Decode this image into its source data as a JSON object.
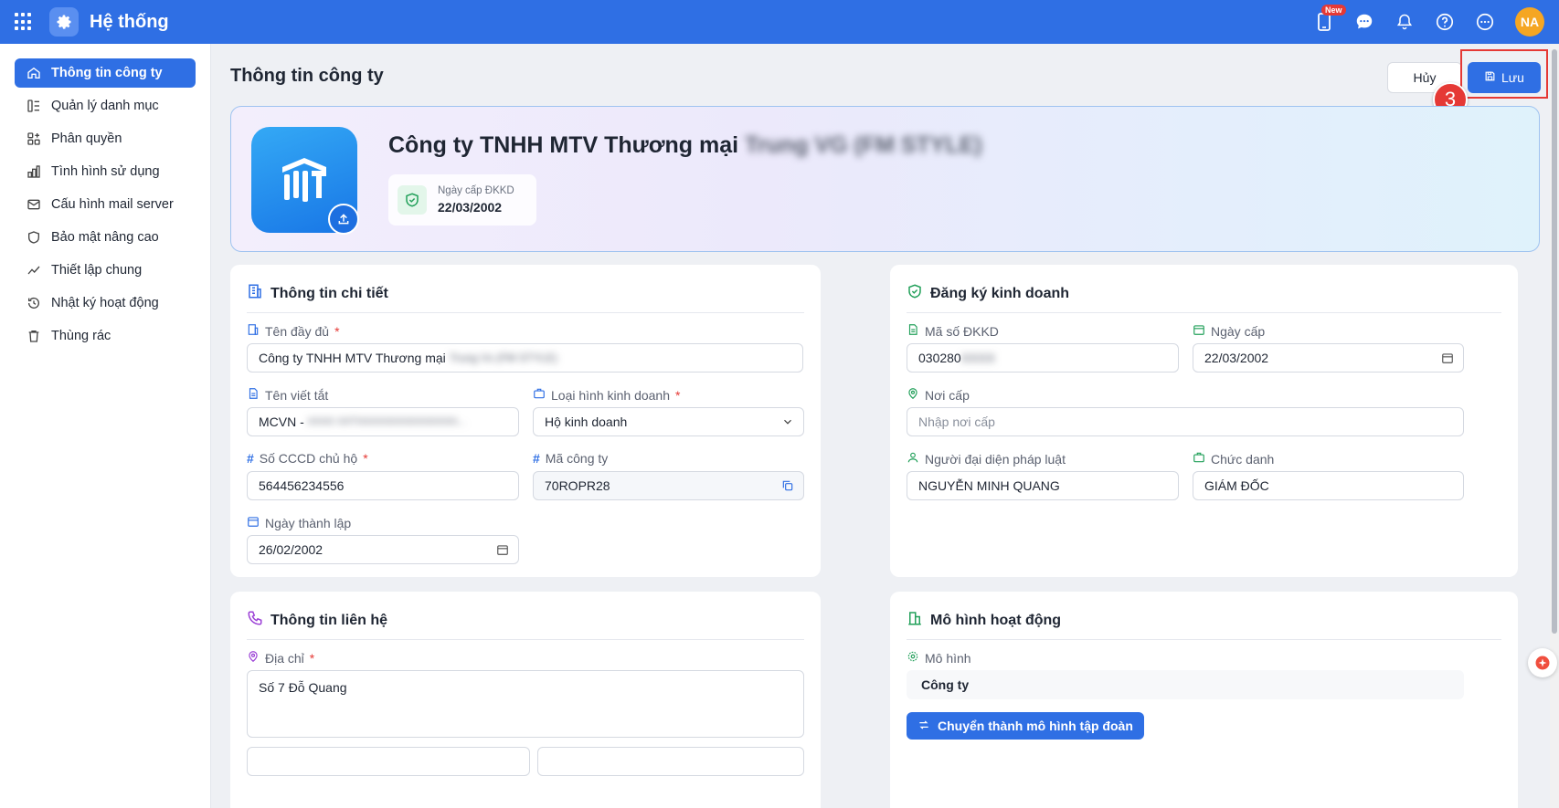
{
  "header": {
    "app_title": "Hệ thống",
    "new_badge": "New",
    "avatar_initials": "NA"
  },
  "sidebar": {
    "items": [
      {
        "label": "Thông tin công ty",
        "icon": "home-icon",
        "active": true
      },
      {
        "label": "Quản lý danh mục",
        "icon": "category-icon"
      },
      {
        "label": "Phân quyền",
        "icon": "permission-icon"
      },
      {
        "label": "Tình hình sử dụng",
        "icon": "chart-icon"
      },
      {
        "label": "Cấu hình mail server",
        "icon": "mail-icon"
      },
      {
        "label": "Bảo mật nâng cao",
        "icon": "shield-icon"
      },
      {
        "label": "Thiết lập chung",
        "icon": "trend-icon"
      },
      {
        "label": "Nhật ký hoạt động",
        "icon": "history-icon"
      },
      {
        "label": "Thùng rác",
        "icon": "trash-icon"
      }
    ]
  },
  "page": {
    "title": "Thông tin công ty",
    "cancel_label": "Hủy",
    "save_label": "Lưu",
    "step_number": "3"
  },
  "hero": {
    "company_name": "Công ty TNHH MTV Thương mại",
    "company_name_blurred": "Trung VG (FM STYLE)",
    "chip_label": "Ngày cấp ĐKKD",
    "chip_value": "22/03/2002"
  },
  "detail": {
    "title": "Thông tin chi tiết",
    "full_name_label": "Tên đầy đủ",
    "full_name_value": "Công ty TNHH MTV Thương mại",
    "full_name_blurred": "Trung Vs (FM STYLE)",
    "short_name_label": "Tên viết tắt",
    "short_name_value": "MCVN -",
    "short_name_blurred": "XXXX XXTXXXXXXXXXXXXXXX...",
    "business_type_label": "Loại hình kinh doanh",
    "business_type_value": "Hộ kinh doanh",
    "cccd_label": "Số CCCD chủ hộ",
    "cccd_value": "564456234556",
    "company_code_label": "Mã công ty",
    "company_code_value": "70ROPR28",
    "founded_label": "Ngày thành lập",
    "founded_value": "26/02/2002"
  },
  "registration": {
    "title": "Đăng ký kinh doanh",
    "reg_no_label": "Mã số ĐKKD",
    "reg_no_value": "030280",
    "reg_no_blurred": "XXXX",
    "issue_date_label": "Ngày cấp",
    "issue_date_value": "22/03/2002",
    "issue_place_label": "Nơi cấp",
    "issue_place_placeholder": "Nhập nơi cấp",
    "legal_rep_label": "Người đại diện pháp luật",
    "legal_rep_value": "NGUYỄN MINH QUANG",
    "position_label": "Chức danh",
    "position_value": "GIÁM ĐỐC"
  },
  "contact": {
    "title": "Thông tin liên hệ",
    "address_label": "Địa chỉ",
    "address_value": "Số 7 Đỗ Quang"
  },
  "model": {
    "title": "Mô hình hoạt động",
    "model_label": "Mô hình",
    "model_value": "Công ty",
    "convert_label": "Chuyển thành mô hình tập đoàn"
  }
}
